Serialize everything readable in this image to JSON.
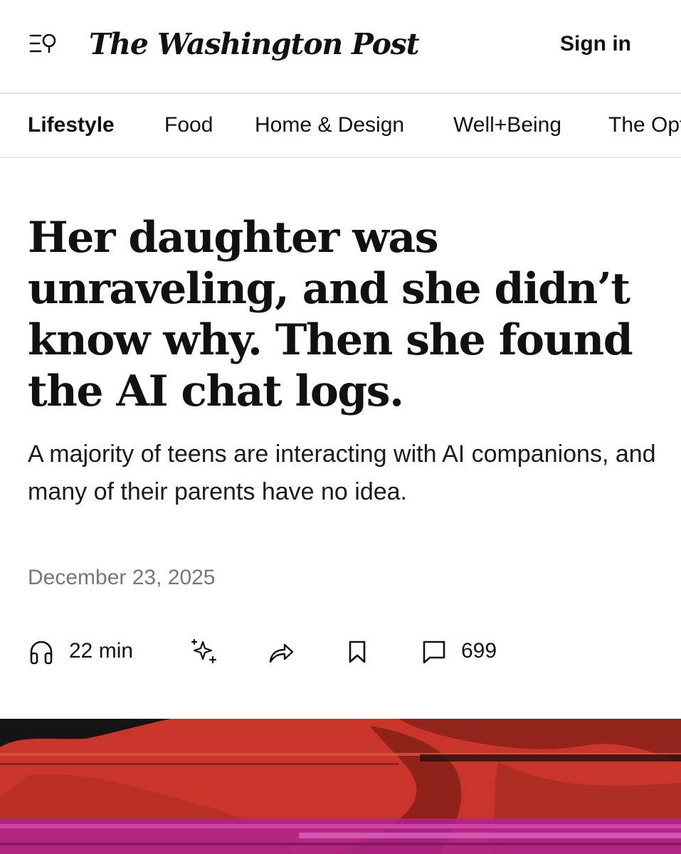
{
  "header": {
    "logo_text": "The Washington Post",
    "signin_label": "Sign in",
    "menu_icon": "menu-search-icon"
  },
  "subnav": {
    "tabs": [
      {
        "label": "Lifestyle",
        "active": true
      },
      {
        "label": "Food",
        "active": false
      },
      {
        "label": "Home & Design",
        "active": false
      },
      {
        "label": "Well+Being",
        "active": false
      },
      {
        "label": "The Opt",
        "active": false
      }
    ]
  },
  "article": {
    "headline": "Her daughter was unraveling, and she didn’t know why. Then she found the AI chat logs.",
    "dek": "A majority of teens are interacting with AI companions, and many of their parents have no idea.",
    "date": "December 23, 2025"
  },
  "actions": {
    "listen_icon": "headphones-icon",
    "listen_duration": "22 min",
    "ai_icon": "sparkles-icon",
    "share_icon": "share-arrow-icon",
    "bookmark_icon": "bookmark-icon",
    "comments_icon": "comment-icon",
    "comments_count": "699"
  },
  "colors": {
    "hero_red": "#c9352a",
    "hero_magenta": "#b0238f",
    "date_gray": "#777777"
  }
}
